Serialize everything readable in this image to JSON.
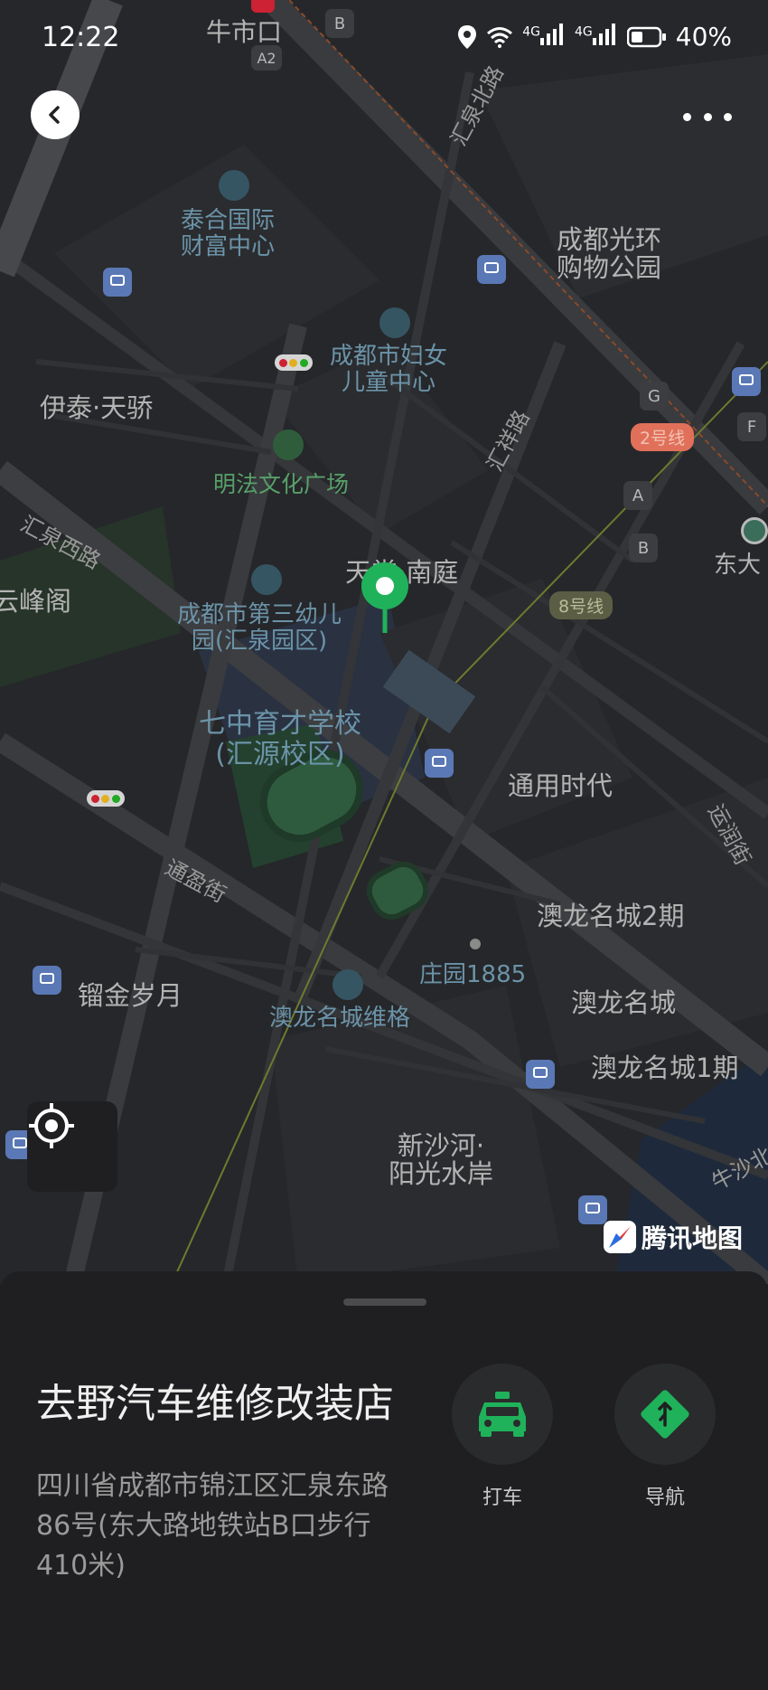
{
  "status_bar": {
    "time": "12:22",
    "network1": "4G",
    "network2": "4G",
    "battery": "40%"
  },
  "map": {
    "labels": {
      "niushikou": "牛市口",
      "a2": "A2",
      "b_top": "B",
      "taihe_1": "泰合国际",
      "taihe_2": "财富中心",
      "huiquan_north": "汇泉北路",
      "chengdu_guanghuan_1": "成都光环",
      "chengdu_guanghuan_2": "购物公园",
      "womens_center_1": "成都市妇女",
      "womens_center_2": "儿童中心",
      "yitai": "伊泰·天骄",
      "mingfa_plaza": "明法文化广场",
      "huixiang_road": "汇祥路",
      "huiquan_west": "汇泉西路",
      "yunfengge": "云峰阁",
      "tiantang": "天堂·南庭",
      "kindergarten_1": "成都市第三幼儿",
      "kindergarten_2": "园(汇泉园区)",
      "school_1": "七中育才学校",
      "school_2": "(汇源校区)",
      "tongyong": "通用时代",
      "tongying_street": "通盈街",
      "aolong_2": "澳龙名城2期",
      "zhuangyuan": "庄园1885",
      "aolong": "澳龙名城",
      "liujin": "镏金岁月",
      "aolong_weige": "澳龙名城维格",
      "aolong_1": "澳龙名城1期",
      "xinshahe_1": "新沙河·",
      "xinshahe_2": "阳光水岸",
      "niusha_north": "牛沙北",
      "yunhe_street": "运润街",
      "dongda": "东大",
      "exit_g": "G",
      "exit_f": "F",
      "exit_a": "A",
      "exit_b": "B",
      "line2": "2号线",
      "line8": "8号线"
    },
    "logo_text": "腾讯地图"
  },
  "place": {
    "name": "去野汽车维修改装店",
    "address": "四川省成都市锦江区汇泉东路86号(东大路地铁站B口步行410米)"
  },
  "actions": {
    "taxi": "打车",
    "navigate": "导航"
  },
  "colors": {
    "accent_green": "#1fb25a",
    "map_bg": "#26272a",
    "sheet_bg": "#1f1f21"
  }
}
